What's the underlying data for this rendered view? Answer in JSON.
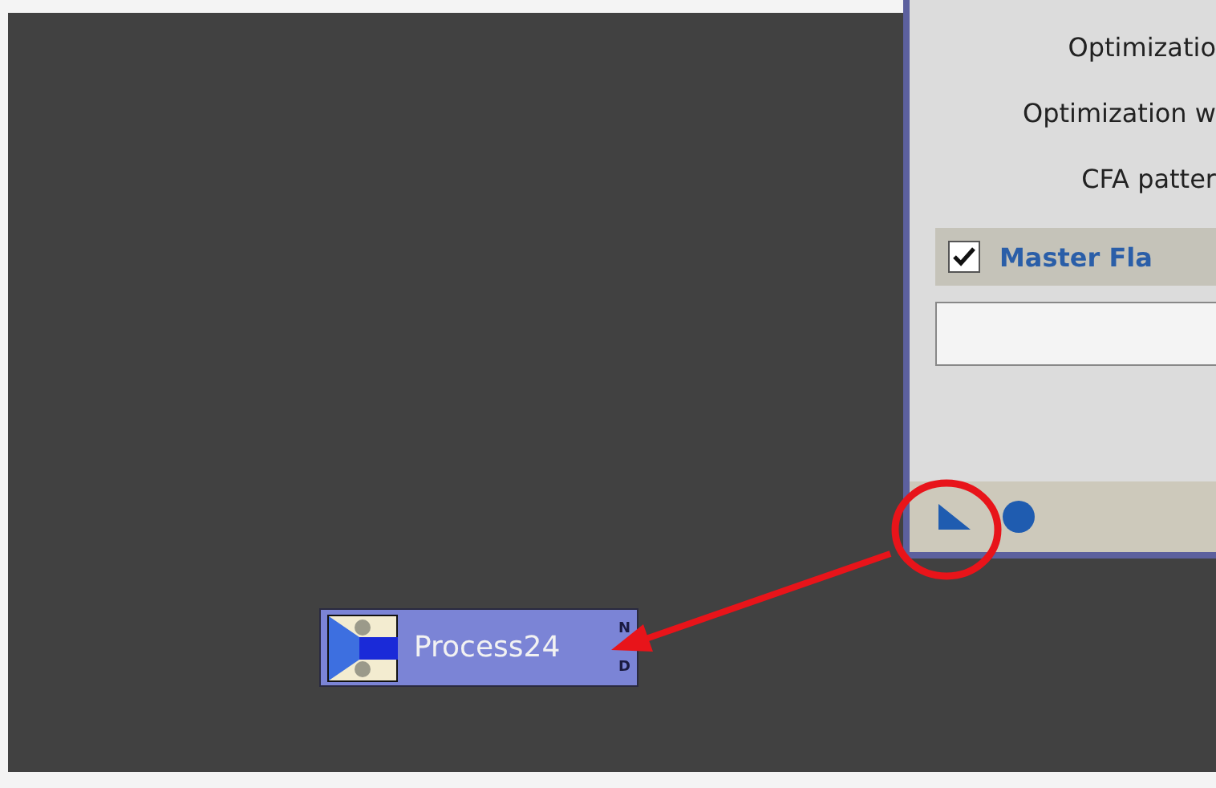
{
  "panel": {
    "labels": [
      "Optimizatio",
      "Optimization w",
      "CFA patter"
    ],
    "checkbox": {
      "label": "Master Fla",
      "checked": true
    }
  },
  "node": {
    "title": "Process24",
    "ports": [
      "N",
      "D"
    ]
  }
}
